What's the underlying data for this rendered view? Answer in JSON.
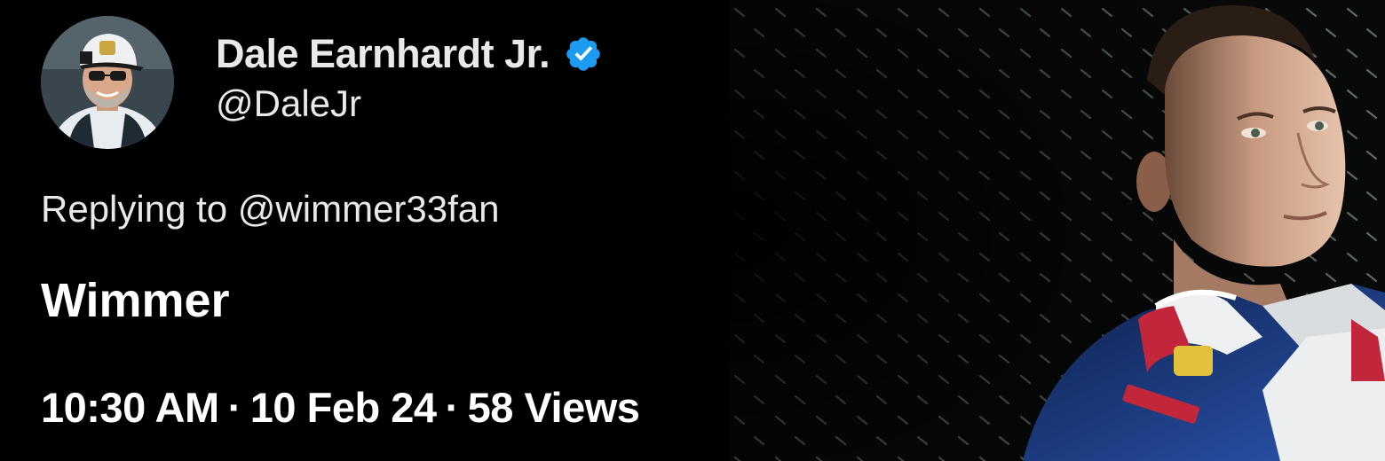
{
  "tweet": {
    "author": {
      "display_name": "Dale Earnhardt Jr.",
      "handle": "@DaleJr",
      "verified": true,
      "avatar_icon": "profile-photo",
      "verified_icon": "verified-badge-icon"
    },
    "reply": {
      "prefix": "Replying to ",
      "mention": "@wimmer33fan"
    },
    "text": "Wimmer",
    "meta": {
      "time": "10:30 AM",
      "date": "10 Feb 24",
      "views": "58 Views",
      "separator": "·"
    }
  },
  "image": {
    "subject": "driver-portrait-photo"
  },
  "colors": {
    "background": "#000000",
    "text": "#e7e9ea",
    "verified_blue": "#1d9bf0"
  }
}
